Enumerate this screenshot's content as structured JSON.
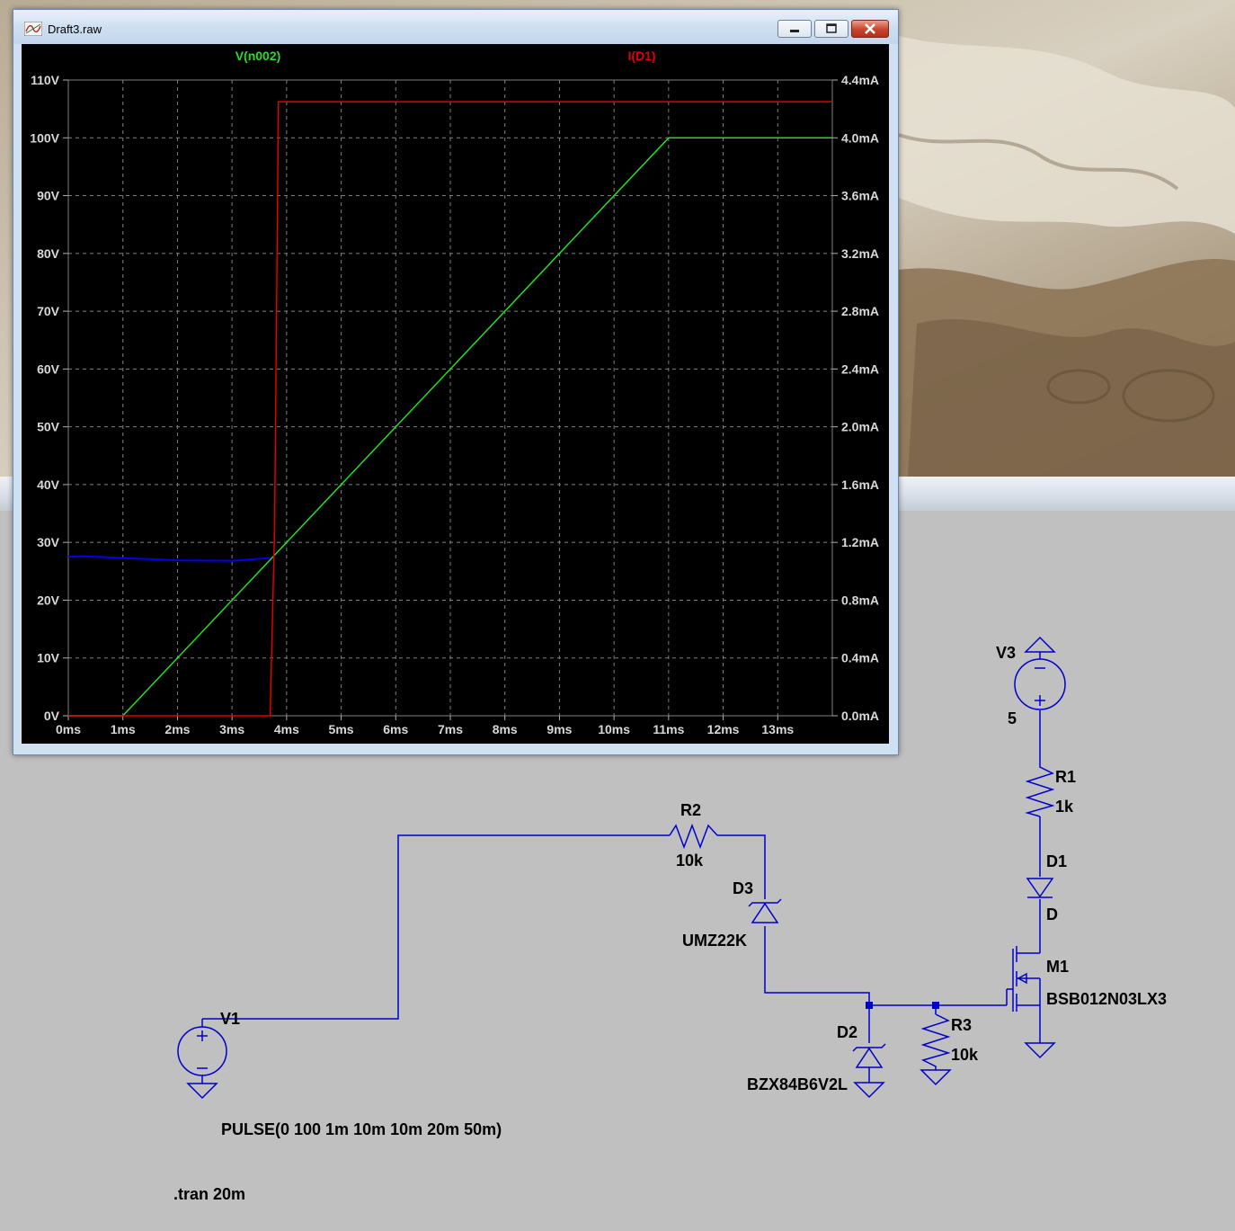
{
  "window": {
    "title": "Draft3.raw"
  },
  "chart_data": {
    "type": "line",
    "x_unit": "ms",
    "x_ticks": [
      "0ms",
      "1ms",
      "2ms",
      "3ms",
      "4ms",
      "5ms",
      "6ms",
      "7ms",
      "8ms",
      "9ms",
      "10ms",
      "11ms",
      "12ms",
      "13ms"
    ],
    "xlim": [
      0,
      14
    ],
    "left_axis": {
      "ticks": [
        "0V",
        "10V",
        "20V",
        "30V",
        "40V",
        "50V",
        "60V",
        "70V",
        "80V",
        "90V",
        "100V",
        "110V"
      ],
      "ylim": [
        0,
        110
      ]
    },
    "right_axis": {
      "ticks": [
        "0.0mA",
        "0.4mA",
        "0.8mA",
        "1.2mA",
        "1.6mA",
        "2.0mA",
        "2.4mA",
        "2.8mA",
        "3.2mA",
        "3.6mA",
        "4.0mA",
        "4.4mA"
      ],
      "ylim": [
        0,
        4.4
      ]
    },
    "grid": true,
    "legend": [
      "V(n002)",
      "I(D1)"
    ],
    "series": [
      {
        "name": "V(n002)",
        "color": "#22dd22",
        "axis": "left",
        "x": [
          0,
          1,
          11,
          14
        ],
        "y": [
          0,
          0,
          100,
          100
        ]
      },
      {
        "name": "I(D1)",
        "color": "#e00000",
        "axis": "right",
        "x": [
          0,
          3.7,
          3.78,
          3.85,
          14
        ],
        "y": [
          0,
          0,
          1.3,
          4.25,
          4.25
        ]
      },
      {
        "color": "#0000ee",
        "axis": "left",
        "x": [
          0,
          0.3,
          1,
          2,
          3,
          3.7
        ],
        "y": [
          27.5,
          27.6,
          27.3,
          26.9,
          26.8,
          27.3
        ]
      }
    ]
  },
  "schematic": {
    "components": {
      "V1": {
        "name": "V1",
        "value": "PULSE(0 100 1m 10m 10m 20m 50m)"
      },
      "V3": {
        "name": "V3",
        "value": "5"
      },
      "R1": {
        "name": "R1",
        "value": "1k"
      },
      "R2": {
        "name": "R2",
        "value": "10k"
      },
      "R3": {
        "name": "R3",
        "value": "10k"
      },
      "D1": {
        "name": "D1",
        "value": "D"
      },
      "D2": {
        "name": "D2",
        "value": "BZX84B6V2L"
      },
      "D3": {
        "name": "D3",
        "value": "UMZ22K"
      },
      "M1": {
        "name": "M1",
        "value": "BSB012N03LX3"
      }
    },
    "directive": ".tran 20m",
    "wire_color": "#0000cc"
  }
}
